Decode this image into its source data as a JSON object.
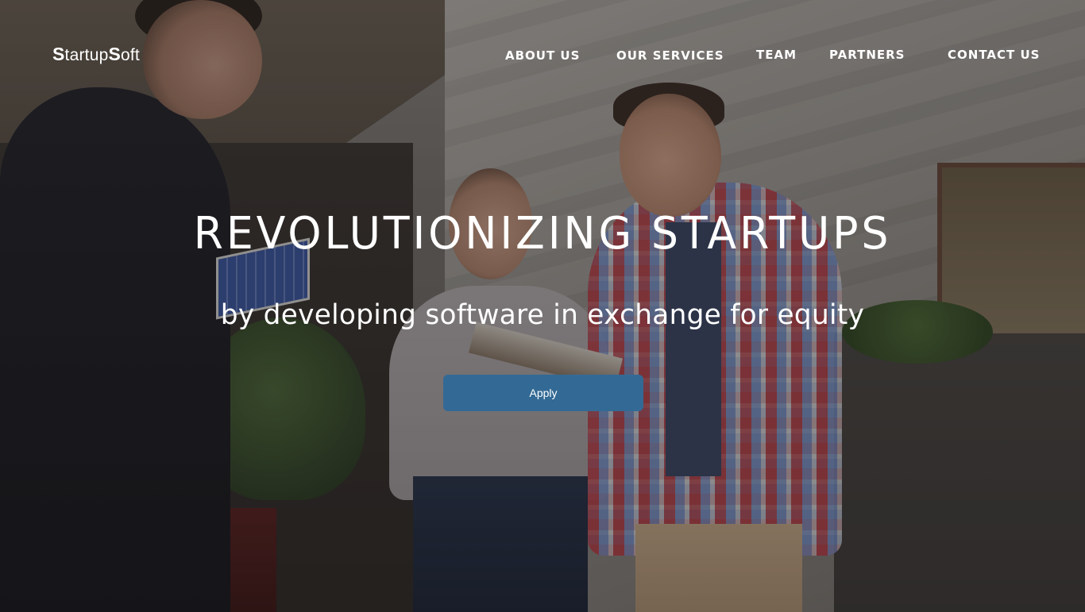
{
  "brand": {
    "logo_text_parts": [
      "S",
      "tartup",
      "S",
      "oft"
    ]
  },
  "nav": {
    "items": [
      {
        "label": "ABOUT US"
      },
      {
        "label": "OUR SERVICES"
      },
      {
        "label": "TEAM"
      },
      {
        "label": "PARTNERS"
      },
      {
        "label": "CONTACT US"
      }
    ]
  },
  "hero": {
    "headline": "REVOLUTIONIZING STARTUPS",
    "subheadline": "by developing software in exchange for equity",
    "cta_label": "Apply"
  },
  "colors": {
    "cta_background": "#336a95",
    "text": "#ffffff",
    "overlay": "rgba(20,18,18,0.38)"
  }
}
